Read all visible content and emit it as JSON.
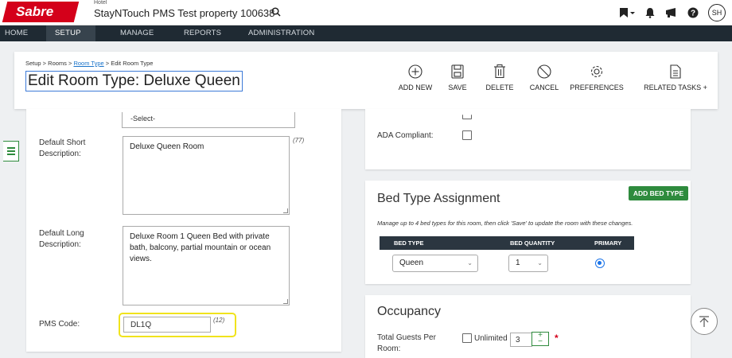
{
  "brand": {
    "logo": "Sabre",
    "hotel_label": "Hotel",
    "property": "StayNTouch PMS Test property 100638"
  },
  "topbar_icons": [
    "bookmark-menu-icon",
    "notification-icon",
    "broadcast-icon",
    "help-icon"
  ],
  "user": {
    "initials": "SH"
  },
  "nav": {
    "items": [
      "HOME",
      "SETUP",
      "MANAGE",
      "REPORTS",
      "ADMINISTRATION"
    ],
    "active": "SETUP"
  },
  "breadcrumb": {
    "part1": "Setup > Rooms > ",
    "link": "Room Type",
    "part2": " > Edit Room Type"
  },
  "page": {
    "title": "Edit Room Type: Deluxe Queen"
  },
  "actions": {
    "add_new": "ADD NEW",
    "save": "SAVE",
    "delete": "DELETE",
    "cancel": "CANCEL",
    "preferences": "PREFERENCES",
    "related_tasks": "RELATED TASKS +"
  },
  "form": {
    "select_value": "-Select-",
    "short_desc_label": "Default Short Description:",
    "short_desc_value": "Deluxe Queen Room",
    "short_desc_count": "(77)",
    "long_desc_label": "Default Long Description:",
    "long_desc_value": "Deluxe Room 1 Queen Bed with private bath, balcony, partial mountain or ocean views.",
    "pms_code_label": "PMS Code:",
    "pms_code_value": "DL1Q",
    "pms_code_count": "(12)"
  },
  "ada": {
    "label": "ADA Compliant:"
  },
  "bed_types": {
    "title": "Bed Type Assignment",
    "add_button": "ADD BED TYPE",
    "hint": "Manage up to 4 bed types for this room, then click 'Save' to update the room with these changes.",
    "columns": [
      "BED TYPE",
      "BED QUANTITY",
      "PRIMARY"
    ],
    "row": {
      "bed_type": "Queen",
      "quantity": "1"
    }
  },
  "occupancy": {
    "title": "Occupancy",
    "total_guests_label": "Total Guests Per Room:",
    "unlimited_label": "Unlimited",
    "guests_value": "3",
    "required_mark": "*"
  }
}
